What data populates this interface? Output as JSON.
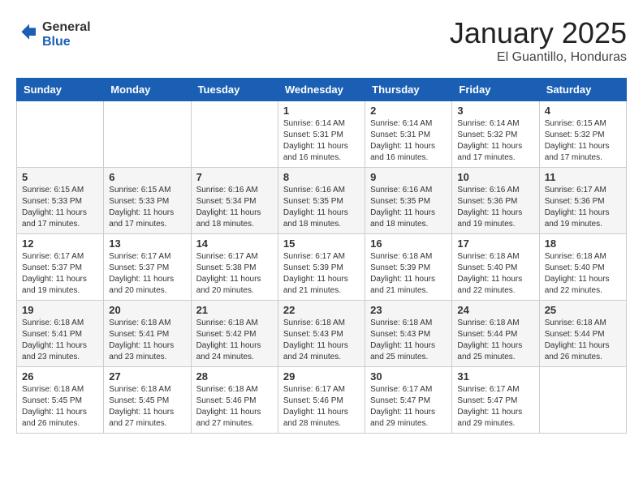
{
  "header": {
    "logo_general": "General",
    "logo_blue": "Blue",
    "month_title": "January 2025",
    "location": "El Guantillo, Honduras"
  },
  "days_of_week": [
    "Sunday",
    "Monday",
    "Tuesday",
    "Wednesday",
    "Thursday",
    "Friday",
    "Saturday"
  ],
  "weeks": [
    [
      {
        "day": "",
        "info": ""
      },
      {
        "day": "",
        "info": ""
      },
      {
        "day": "",
        "info": ""
      },
      {
        "day": "1",
        "info": "Sunrise: 6:14 AM\nSunset: 5:31 PM\nDaylight: 11 hours and 16 minutes."
      },
      {
        "day": "2",
        "info": "Sunrise: 6:14 AM\nSunset: 5:31 PM\nDaylight: 11 hours and 16 minutes."
      },
      {
        "day": "3",
        "info": "Sunrise: 6:14 AM\nSunset: 5:32 PM\nDaylight: 11 hours and 17 minutes."
      },
      {
        "day": "4",
        "info": "Sunrise: 6:15 AM\nSunset: 5:32 PM\nDaylight: 11 hours and 17 minutes."
      }
    ],
    [
      {
        "day": "5",
        "info": "Sunrise: 6:15 AM\nSunset: 5:33 PM\nDaylight: 11 hours and 17 minutes."
      },
      {
        "day": "6",
        "info": "Sunrise: 6:15 AM\nSunset: 5:33 PM\nDaylight: 11 hours and 17 minutes."
      },
      {
        "day": "7",
        "info": "Sunrise: 6:16 AM\nSunset: 5:34 PM\nDaylight: 11 hours and 18 minutes."
      },
      {
        "day": "8",
        "info": "Sunrise: 6:16 AM\nSunset: 5:35 PM\nDaylight: 11 hours and 18 minutes."
      },
      {
        "day": "9",
        "info": "Sunrise: 6:16 AM\nSunset: 5:35 PM\nDaylight: 11 hours and 18 minutes."
      },
      {
        "day": "10",
        "info": "Sunrise: 6:16 AM\nSunset: 5:36 PM\nDaylight: 11 hours and 19 minutes."
      },
      {
        "day": "11",
        "info": "Sunrise: 6:17 AM\nSunset: 5:36 PM\nDaylight: 11 hours and 19 minutes."
      }
    ],
    [
      {
        "day": "12",
        "info": "Sunrise: 6:17 AM\nSunset: 5:37 PM\nDaylight: 11 hours and 19 minutes."
      },
      {
        "day": "13",
        "info": "Sunrise: 6:17 AM\nSunset: 5:37 PM\nDaylight: 11 hours and 20 minutes."
      },
      {
        "day": "14",
        "info": "Sunrise: 6:17 AM\nSunset: 5:38 PM\nDaylight: 11 hours and 20 minutes."
      },
      {
        "day": "15",
        "info": "Sunrise: 6:17 AM\nSunset: 5:39 PM\nDaylight: 11 hours and 21 minutes."
      },
      {
        "day": "16",
        "info": "Sunrise: 6:18 AM\nSunset: 5:39 PM\nDaylight: 11 hours and 21 minutes."
      },
      {
        "day": "17",
        "info": "Sunrise: 6:18 AM\nSunset: 5:40 PM\nDaylight: 11 hours and 22 minutes."
      },
      {
        "day": "18",
        "info": "Sunrise: 6:18 AM\nSunset: 5:40 PM\nDaylight: 11 hours and 22 minutes."
      }
    ],
    [
      {
        "day": "19",
        "info": "Sunrise: 6:18 AM\nSunset: 5:41 PM\nDaylight: 11 hours and 23 minutes."
      },
      {
        "day": "20",
        "info": "Sunrise: 6:18 AM\nSunset: 5:41 PM\nDaylight: 11 hours and 23 minutes."
      },
      {
        "day": "21",
        "info": "Sunrise: 6:18 AM\nSunset: 5:42 PM\nDaylight: 11 hours and 24 minutes."
      },
      {
        "day": "22",
        "info": "Sunrise: 6:18 AM\nSunset: 5:43 PM\nDaylight: 11 hours and 24 minutes."
      },
      {
        "day": "23",
        "info": "Sunrise: 6:18 AM\nSunset: 5:43 PM\nDaylight: 11 hours and 25 minutes."
      },
      {
        "day": "24",
        "info": "Sunrise: 6:18 AM\nSunset: 5:44 PM\nDaylight: 11 hours and 25 minutes."
      },
      {
        "day": "25",
        "info": "Sunrise: 6:18 AM\nSunset: 5:44 PM\nDaylight: 11 hours and 26 minutes."
      }
    ],
    [
      {
        "day": "26",
        "info": "Sunrise: 6:18 AM\nSunset: 5:45 PM\nDaylight: 11 hours and 26 minutes."
      },
      {
        "day": "27",
        "info": "Sunrise: 6:18 AM\nSunset: 5:45 PM\nDaylight: 11 hours and 27 minutes."
      },
      {
        "day": "28",
        "info": "Sunrise: 6:18 AM\nSunset: 5:46 PM\nDaylight: 11 hours and 27 minutes."
      },
      {
        "day": "29",
        "info": "Sunrise: 6:17 AM\nSunset: 5:46 PM\nDaylight: 11 hours and 28 minutes."
      },
      {
        "day": "30",
        "info": "Sunrise: 6:17 AM\nSunset: 5:47 PM\nDaylight: 11 hours and 29 minutes."
      },
      {
        "day": "31",
        "info": "Sunrise: 6:17 AM\nSunset: 5:47 PM\nDaylight: 11 hours and 29 minutes."
      },
      {
        "day": "",
        "info": ""
      }
    ]
  ]
}
